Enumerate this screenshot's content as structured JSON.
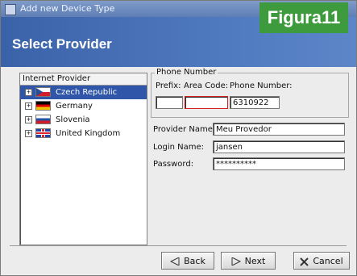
{
  "window": {
    "title": "Add new Device Type"
  },
  "badge": {
    "text": "Figura11"
  },
  "header": {
    "title": "Select Provider"
  },
  "tree": {
    "header": "Internet Provider",
    "items": [
      {
        "label": "Czech Republic",
        "flag": "czech-flag-icon",
        "selected": true
      },
      {
        "label": "Germany",
        "flag": "germany-flag-icon",
        "selected": false
      },
      {
        "label": "Slovenia",
        "flag": "slovenia-flag-icon",
        "selected": false
      },
      {
        "label": "United Kingdom",
        "flag": "uk-flag-icon",
        "selected": false
      }
    ]
  },
  "phone": {
    "legend": "Phone Number",
    "prefix_label": "Prefix:",
    "area_label": "Area Code:",
    "number_label": "Phone Number:",
    "prefix_value": "",
    "area_value": "",
    "number_value": "6310922"
  },
  "provider": {
    "name_label": "Provider Name:",
    "name_value": "Meu Provedor",
    "login_label": "Login Name:",
    "login_value": "jansen",
    "password_label": "Password:",
    "password_value": "**********"
  },
  "buttons": {
    "back": "Back",
    "next": "Next",
    "cancel": "Cancel"
  },
  "colors": {
    "header": "#3a62a8",
    "selection": "#2f56a8",
    "badge": "#3d9a3d"
  }
}
